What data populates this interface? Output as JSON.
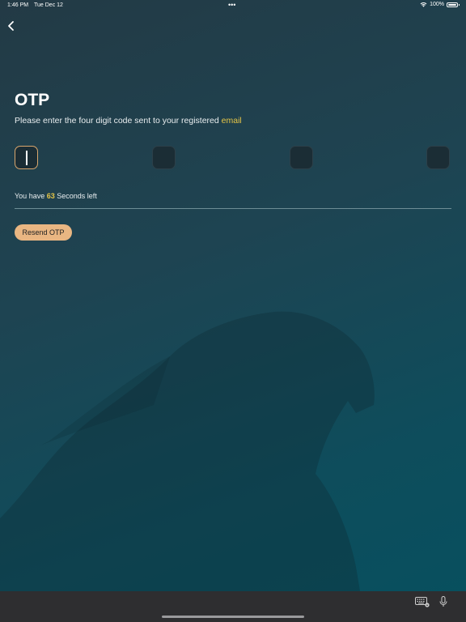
{
  "status_bar": {
    "time": "1:46 PM",
    "date": "Tue Dec 12",
    "dots": "•••",
    "battery": "100%"
  },
  "header": {
    "back_icon": "chevron-left-icon"
  },
  "otp": {
    "title": "OTP",
    "subtitle_prefix": "Please enter the four digit code sent to your registered ",
    "subtitle_link": "email",
    "digits": [
      "",
      "",
      "",
      ""
    ],
    "active_index": 0
  },
  "timer": {
    "prefix": "You have ",
    "seconds": "63",
    "suffix": " Seconds left"
  },
  "actions": {
    "resend_label": "Resend OTP"
  },
  "keyboard_bar": {
    "keyboard_icon": "keyboard-icon",
    "mic_icon": "microphone-icon"
  },
  "colors": {
    "accent_yellow": "#e6c547",
    "button_peach": "#e9b682",
    "active_border": "#d9a66d",
    "background_dark": "#233a45",
    "background_teal": "#07505f"
  }
}
